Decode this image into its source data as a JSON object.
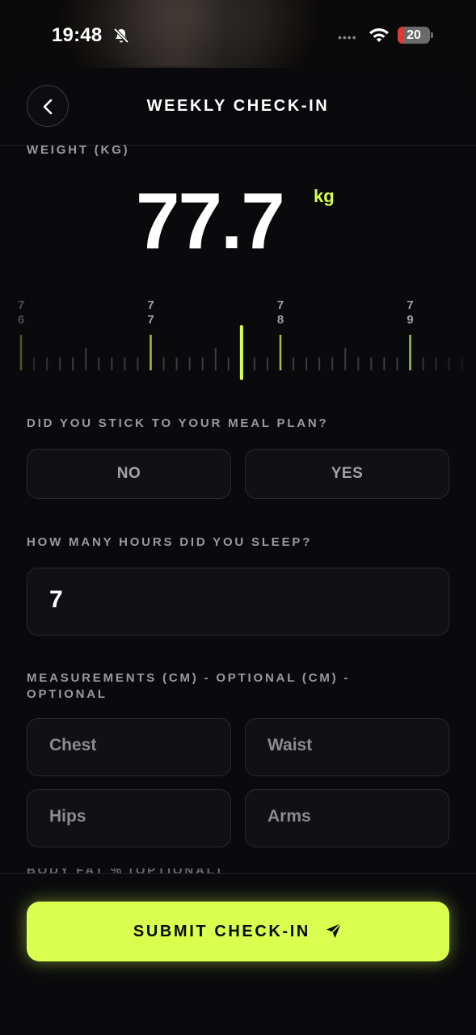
{
  "status_bar": {
    "time": "19:48",
    "battery": "20",
    "battery_level": 0.2
  },
  "header": {
    "title": "WEEKLY CHECK-IN"
  },
  "weight": {
    "label": "WEIGHT (KG)",
    "value": "77.7",
    "unit": "kg"
  },
  "ruler": {
    "ticks": [
      {
        "line1": "7",
        "line2": "6"
      },
      {
        "line1": "7",
        "line2": "7"
      },
      {
        "line1": "7",
        "line2": "8"
      },
      {
        "line1": "7",
        "line2": "9"
      }
    ],
    "selected_value": 77.7,
    "accent_color": "#d9ff4f"
  },
  "meal_plan": {
    "label": "DID YOU STICK TO YOUR MEAL PLAN?",
    "no_label": "NO",
    "yes_label": "YES"
  },
  "sleep": {
    "label": "HOW MANY HOURS DID YOU SLEEP?",
    "value": "7"
  },
  "measurements": {
    "label_line1": "MEASUREMENTS (CM) - OPTIONAL (CM) -",
    "label_line2": "OPTIONAL",
    "chest": "Chest",
    "waist": "Waist",
    "hips": "Hips",
    "arms": "Arms"
  },
  "body_fat": {
    "label": "BODY FAT % (OPTIONAL)"
  },
  "footer": {
    "submit_label": "SUBMIT CHECK-IN"
  }
}
